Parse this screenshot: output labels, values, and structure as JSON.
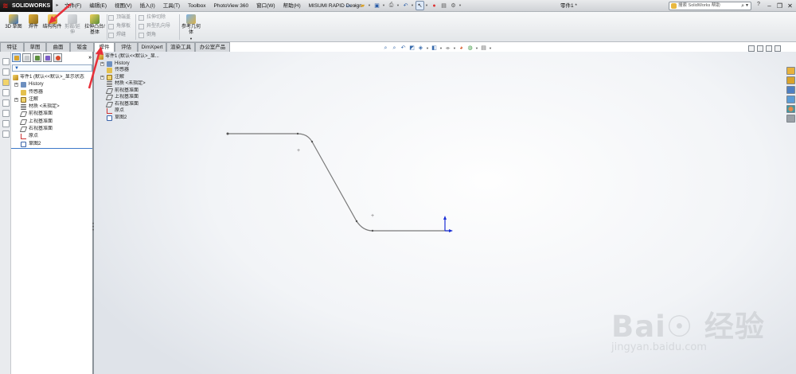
{
  "app": {
    "logo_text": "SOLIDWORKS",
    "doc_title": "零件1 *"
  },
  "menu": {
    "items": [
      "文件(F)",
      "编辑(E)",
      "视图(V)",
      "插入(I)",
      "工具(T)",
      "Toolbox",
      "PhotoView 360",
      "窗口(W)",
      "帮助(H)",
      "MISUMI RAPID Design"
    ]
  },
  "search": {
    "placeholder": "搜索 SolidWorks 帮助"
  },
  "ribbon": {
    "sketch3d": "3D 草图",
    "weldment": "焊件",
    "structural_member": "结构构件",
    "trim_extend": "剪裁/延伸",
    "extruded_boss": "拉伸凸台/基体",
    "top_small": [
      "顶端盖",
      "角撑板",
      "焊缝"
    ],
    "cut_small": [
      "拉伸切除",
      "异型孔向导",
      "倒角"
    ],
    "ref_geom": "参考几何体"
  },
  "command_tabs": {
    "left": [
      "特征",
      "草图",
      "曲面",
      "钣金"
    ],
    "right": [
      "焊件",
      "评估",
      "DimXpert",
      "渲染工具",
      "办公室产品"
    ],
    "active": "焊件"
  },
  "feature_tree": {
    "root": "零件1 (默认<<默认>_显示状态",
    "items": [
      "History",
      "传感器",
      "注解",
      "材质 <未指定>",
      "前视基准面",
      "上视基准面",
      "右视基准面",
      "原点",
      "草图2"
    ]
  },
  "flyout_tree": {
    "root": "零件1 (默认<<默认>_显...",
    "items": [
      "History",
      "传感器",
      "注解",
      "材质 <未指定>",
      "前视基准面",
      "上视基准面",
      "右视基准面",
      "原点",
      "草图2"
    ]
  },
  "watermark": {
    "brand": "Bai☉ 经验",
    "url": "jingyan.baidu.com"
  },
  "colors": {
    "accent_blue": "#1f5fb7",
    "annotation_red": "#e8303a",
    "sketch_line": "#7a7a7a",
    "origin_blue": "#1a2fd6"
  }
}
